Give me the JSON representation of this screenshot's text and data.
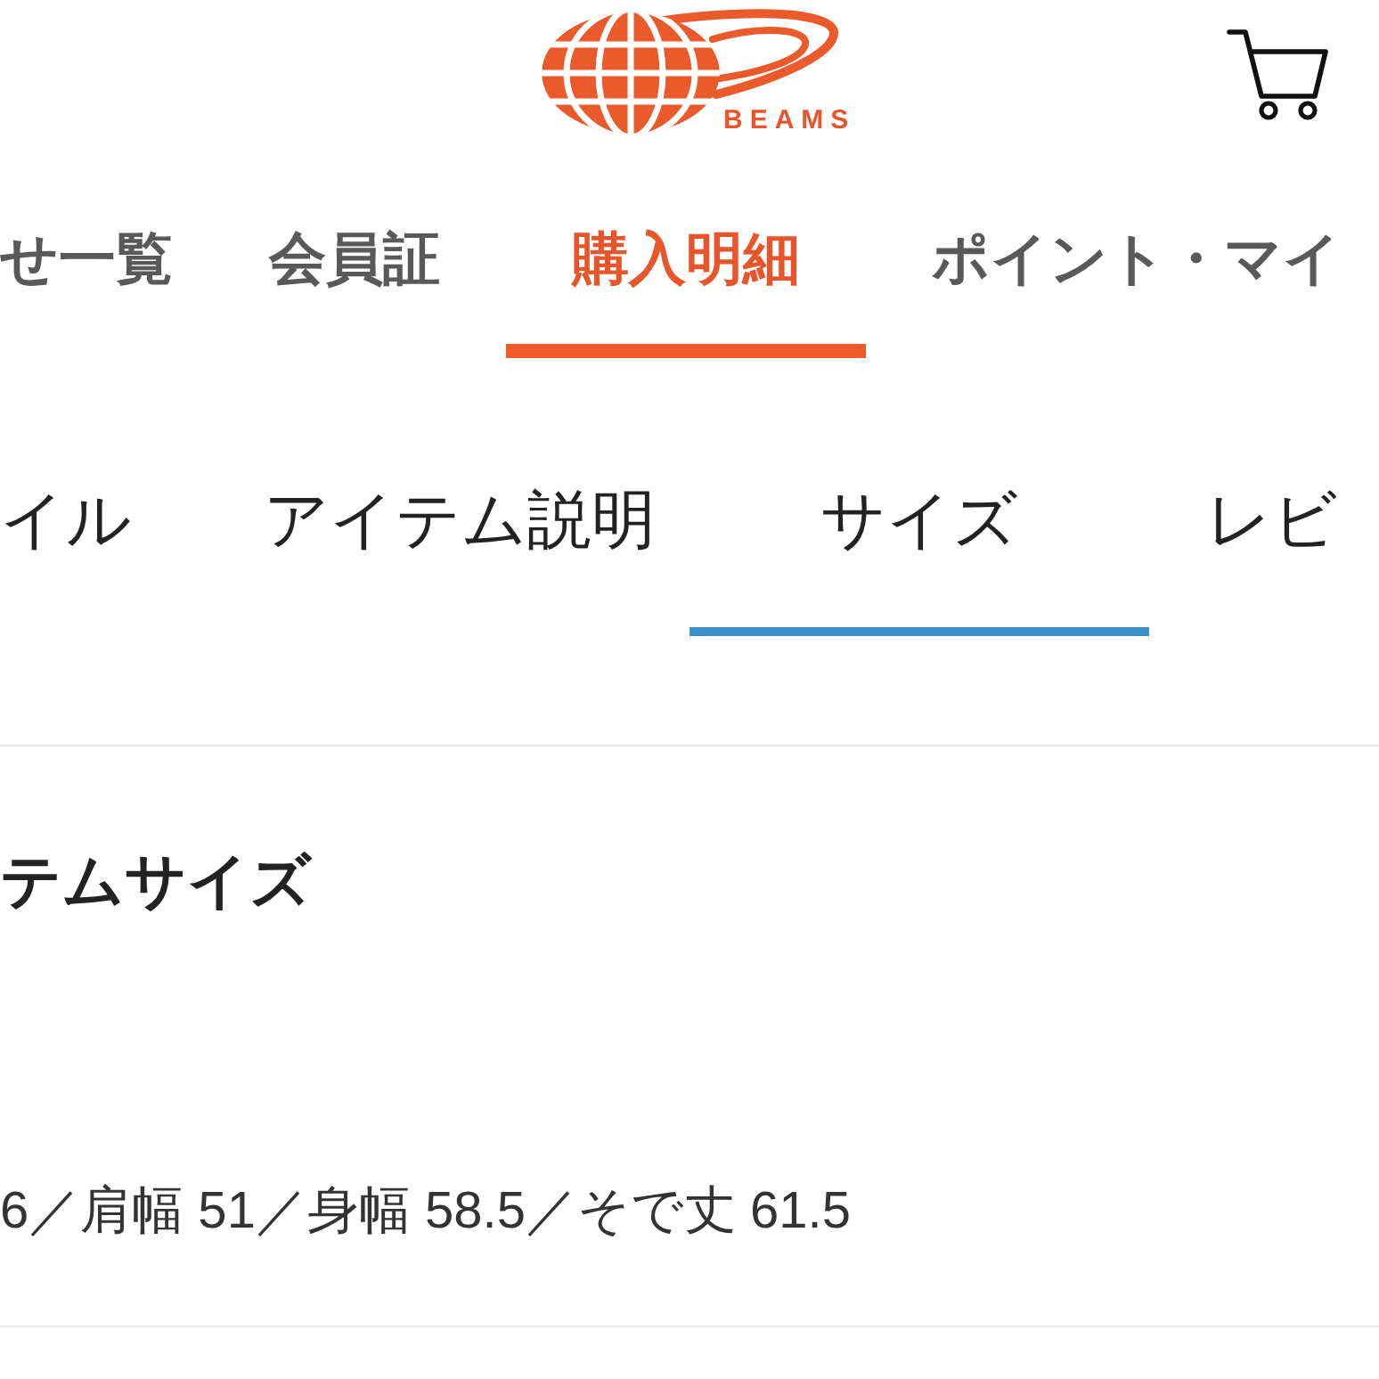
{
  "header": {
    "logo_text": "BEAMS"
  },
  "main_tabs": [
    {
      "label": "せ一覧",
      "selected": false
    },
    {
      "label": "会員証",
      "selected": false
    },
    {
      "label": "購入明細",
      "selected": true
    },
    {
      "label": "ポイント・マイ",
      "selected": false
    }
  ],
  "item_tabs": [
    {
      "label": "イル",
      "selected": false
    },
    {
      "label": "アイテム説明",
      "selected": false
    },
    {
      "label": "サイズ",
      "selected": true
    },
    {
      "label": "レビ",
      "selected": false
    }
  ],
  "size_section": {
    "heading": "テムサイズ",
    "measurements": "6／肩幅 51／身幅 58.5／そで丈 61.5"
  }
}
